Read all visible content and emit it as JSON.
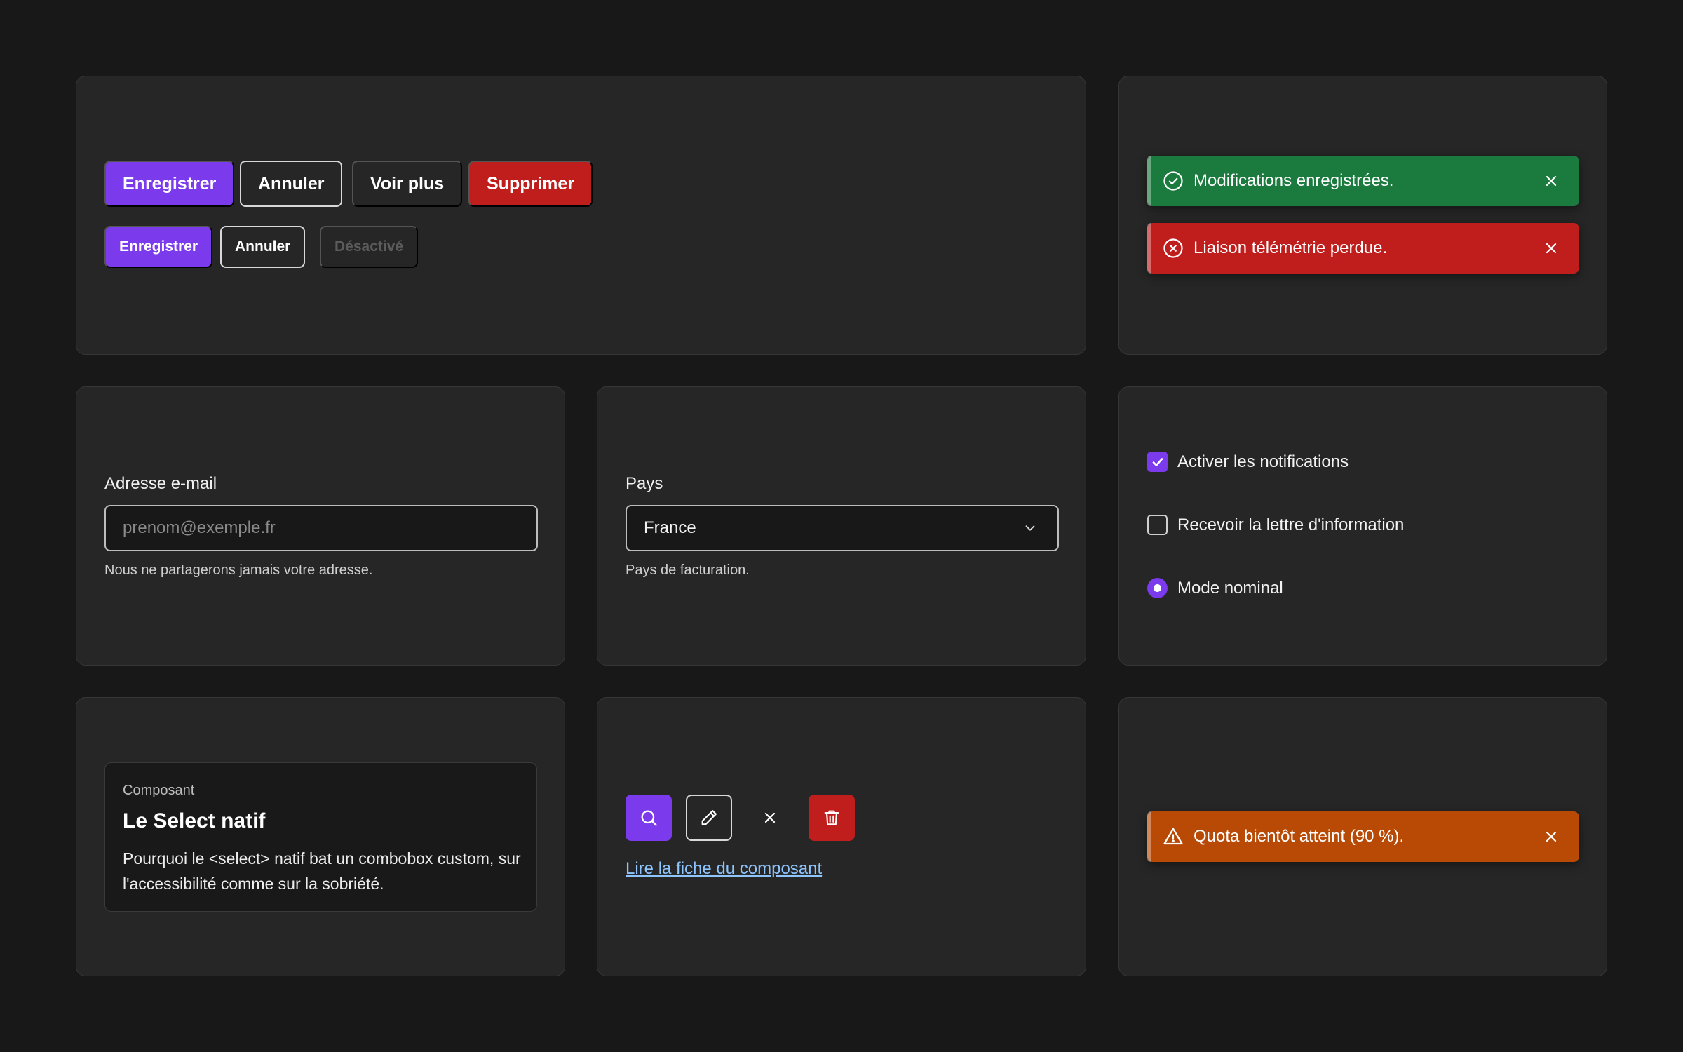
{
  "buttons": {
    "large": {
      "primary": "Enregistrer",
      "outline": "Annuler",
      "ghost": "Voir plus",
      "danger": "Supprimer"
    },
    "small": {
      "primary": "Enregistrer",
      "outline": "Annuler",
      "disabled": "Désactivé"
    }
  },
  "toasts": {
    "success": {
      "message": "Modifications enregistrées.",
      "icon": "check-circle-icon"
    },
    "error": {
      "message": "Liaison télémétrie perdue.",
      "icon": "x-circle-icon"
    },
    "warning": {
      "message": "Quota bientôt atteint (90 %).",
      "icon": "warning-triangle-icon"
    }
  },
  "email_field": {
    "label": "Adresse e-mail",
    "placeholder": "prenom@exemple.fr",
    "value": "",
    "help": "Nous ne partagerons jamais votre adresse."
  },
  "country_field": {
    "label": "Pays",
    "value": "France",
    "help": "Pays de facturation."
  },
  "options": {
    "notifications": {
      "label": "Activer les notifications",
      "checked": true
    },
    "newsletter": {
      "label": "Recevoir la lettre d'information",
      "checked": false
    },
    "mode": {
      "label": "Mode nominal",
      "selected": true
    }
  },
  "article_card": {
    "eyebrow": "Composant",
    "title": "Le Select natif",
    "body": "Pourquoi le <select> natif bat un combobox custom, sur l'accessibilité comme sur la sobriété."
  },
  "icon_buttons": [
    "search-icon",
    "pencil-icon",
    "close-icon",
    "trash-icon"
  ],
  "link_text": "Lire la fiche du composant",
  "colors": {
    "background": "#181818",
    "card": "#262626",
    "accent": "#7c3aed",
    "danger": "#c01d1d",
    "success": "#1b7a3e",
    "warning": "#b84a06",
    "link": "#8ec5ff"
  }
}
